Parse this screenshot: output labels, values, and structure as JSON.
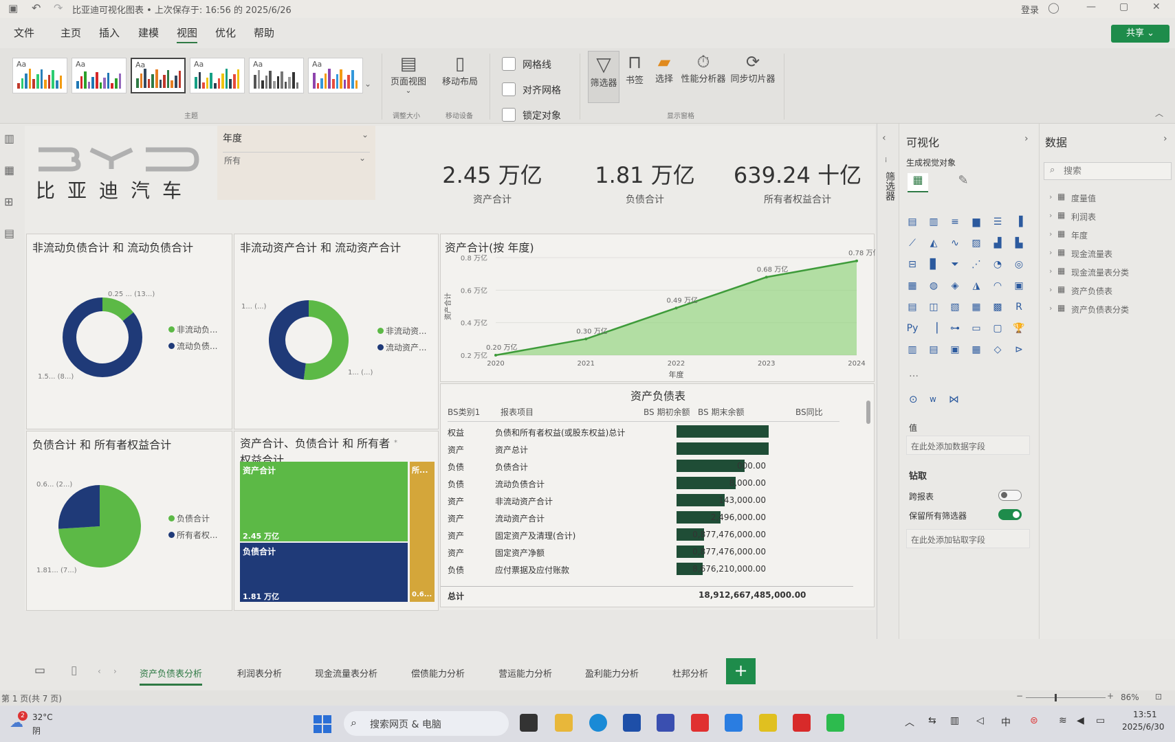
{
  "titlebar": {
    "title": "比亚迪可视化图表 • 上次保存于: 16:56 的 2025/6/26",
    "login": "登录"
  },
  "menu": [
    "文件",
    "主页",
    "插入",
    "建模",
    "视图",
    "优化",
    "帮助"
  ],
  "share_label": "共享",
  "ribbon": {
    "theme_label": "主题",
    "theme_aa": "Aa",
    "page_view": "页面视图",
    "fit_group": "调整大小",
    "mobile_layout": "移动布局",
    "mobile_group": "移动设备",
    "gridlines": "网格线",
    "snap_grid": "对齐网格",
    "lock_objects": "锁定对象",
    "filters": "筛选器",
    "bookmarks": "书签",
    "selection": "选择",
    "perf_analyzer": "性能分析器",
    "sync_slicers": "同步切片器",
    "show_panes_group": "显示窗格"
  },
  "logo": {
    "text": "比亚迪汽车"
  },
  "slicer": {
    "title": "年度",
    "value": "所有"
  },
  "kpis": [
    {
      "value": "2.45 万亿",
      "label": "资产合计"
    },
    {
      "value": "1.81 万亿",
      "label": "负债合计"
    },
    {
      "value": "639.24 十亿",
      "label": "所有者权益合计"
    }
  ],
  "donut1": {
    "title": "非流动负债合计 和 流动负债合计",
    "label_top": "0.25 ... (13...)",
    "label_bottom": "1.5... (8...)",
    "legend": [
      "非流动负...",
      "流动负债..."
    ],
    "fraction": 0.142
  },
  "donut2": {
    "title": "非流动资产合计 和 流动资产合计",
    "label_top": "1... (...)",
    "label_bottom": "1... (...)",
    "legend": [
      "非流动资...",
      "流动资产..."
    ],
    "fraction": 0.52
  },
  "pie": {
    "title": "负债合计 和 所有者权益合计",
    "label_top": "0.6... (2...)",
    "label_bottom": "1.81... (7...)",
    "legend": [
      "负债合计",
      "所有者权..."
    ],
    "fraction": 0.26
  },
  "treemap": {
    "title": "资产合计、负债合计 和 所有者权益合计",
    "asset_label": "资产合计",
    "asset_value": "2.45 万亿",
    "liab_label": "负债合计",
    "liab_value": "1.81 万亿",
    "equity_label": "所...",
    "equity_value": "0.6..."
  },
  "colors": {
    "green": "#5cb946",
    "navy": "#1f3a78",
    "gold": "#d4a63a",
    "bar": "#1f4d36",
    "accent": "#1e8c4b"
  },
  "chart_data": {
    "type": "area",
    "title": "资产合计(按 年度)",
    "xlabel": "年度",
    "ylabel": "资产合计",
    "x": [
      2020,
      2021,
      2022,
      2023,
      2024
    ],
    "values": [
      0.2,
      0.3,
      0.49,
      0.68,
      0.78
    ],
    "data_labels": [
      "0.20 万亿",
      "0.30 万亿",
      "0.49 万亿",
      "0.68 万亿",
      "0.78 万亿"
    ],
    "yticks": [
      "0.8 万亿",
      "0.6 万亿",
      "0.4 万亿",
      "0.2 万亿"
    ],
    "ylim": [
      0.2,
      0.8
    ]
  },
  "table": {
    "title": "资产负债表",
    "headers": [
      "BS类别1",
      "报表项目",
      "BS 期初余额",
      "BS 期末余额",
      "BS同比"
    ],
    "rows": [
      {
        "cat": "权益",
        "item": "负债和所有者权益(或股东权益)总计",
        "end": "",
        "frac": 1.0
      },
      {
        "cat": "资产",
        "item": "资产总计",
        "end": "",
        "frac": 1.0
      },
      {
        "cat": "负债",
        "item": "负债合计",
        "end": "000.00",
        "frac": 0.74
      },
      {
        "cat": "负债",
        "item": "流动负债合计",
        "end": "8,000.00",
        "frac": 0.64
      },
      {
        "cat": "资产",
        "item": "非流动资产合计",
        "end": "143,000.00",
        "frac": 0.52
      },
      {
        "cat": "资产",
        "item": "流动资产合计",
        "end": "2,496,000.00",
        "frac": 0.48
      },
      {
        "cat": "资产",
        "item": "固定资产及清理(合计)",
        "end": "0,877,476,000.00",
        "frac": 0.3
      },
      {
        "cat": "资产",
        "item": "固定资产净额",
        "end": "0,877,476,000.00",
        "frac": 0.3
      },
      {
        "cat": "负债",
        "item": "应付票据及应付账款",
        "end": "8,676,210,000.00",
        "frac": 0.28
      }
    ],
    "total_label": "总计",
    "total_value": "18,912,667,485,000.00"
  },
  "filters_pane_label": "筛选器",
  "viz_pane": {
    "title": "可视化",
    "build": "生成视觉对象",
    "values": "值",
    "add_data": "在此处添加数据字段",
    "drill": "钻取",
    "cross_report": "跨报表",
    "keep_filters": "保留所有筛选器",
    "add_drill": "在此处添加钻取字段"
  },
  "data_pane": {
    "title": "数据",
    "search_placeholder": "搜索",
    "items": [
      "度量值",
      "利润表",
      "年度",
      "现金流量表",
      "现金流量表分类",
      "资产负债表",
      "资产负债表分类"
    ]
  },
  "tabs": [
    "资产负债表分析",
    "利润表分析",
    "现金流量表分析",
    "偿债能力分析",
    "营运能力分析",
    "盈利能力分析",
    "杜邦分析"
  ],
  "status": {
    "page": "第 1 页(共 7 页)",
    "zoom": "86%"
  },
  "taskbar": {
    "temp": "32°C",
    "weather": "阴",
    "search": "搜索网页 & 电脑",
    "time": "13:51",
    "date": "2025/6/30"
  }
}
